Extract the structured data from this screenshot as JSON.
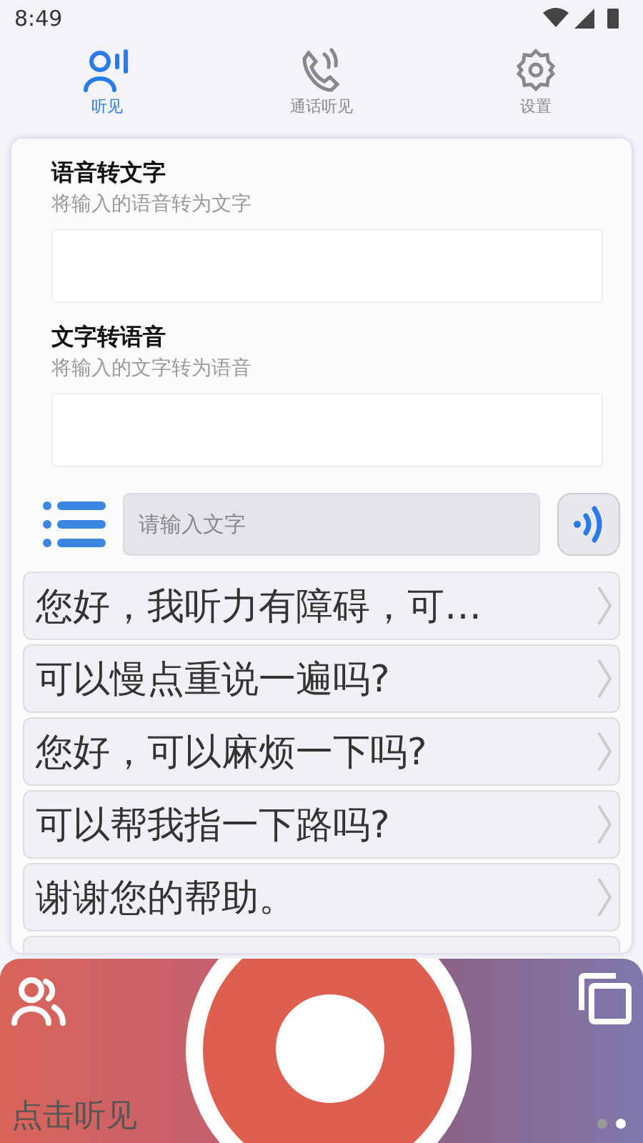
{
  "status_bar": {
    "time": "8:49"
  },
  "tabs": [
    {
      "label": "听见",
      "selected": true,
      "kind": "listen"
    },
    {
      "label": "通话听见",
      "selected": false,
      "kind": "call"
    },
    {
      "label": "设置",
      "selected": false,
      "kind": "settings"
    }
  ],
  "sections": [
    {
      "title": "语音转文字",
      "subtitle": "将输入的语音转为文字"
    },
    {
      "title": "文字转语音",
      "subtitle": "将输入的文字转为语音"
    }
  ],
  "text_input": {
    "placeholder": "请输入文字"
  },
  "phrases": [
    "您好，我听力有障碍，可…",
    "可以慢点重说一遍吗?",
    "您好，可以麻烦一下吗?",
    "可以帮我指一下路吗?",
    "谢谢您的帮助。"
  ],
  "bottom_panel": {
    "label": "点击听见",
    "pages": [
      {
        "selected": false
      },
      {
        "selected": true
      }
    ]
  }
}
